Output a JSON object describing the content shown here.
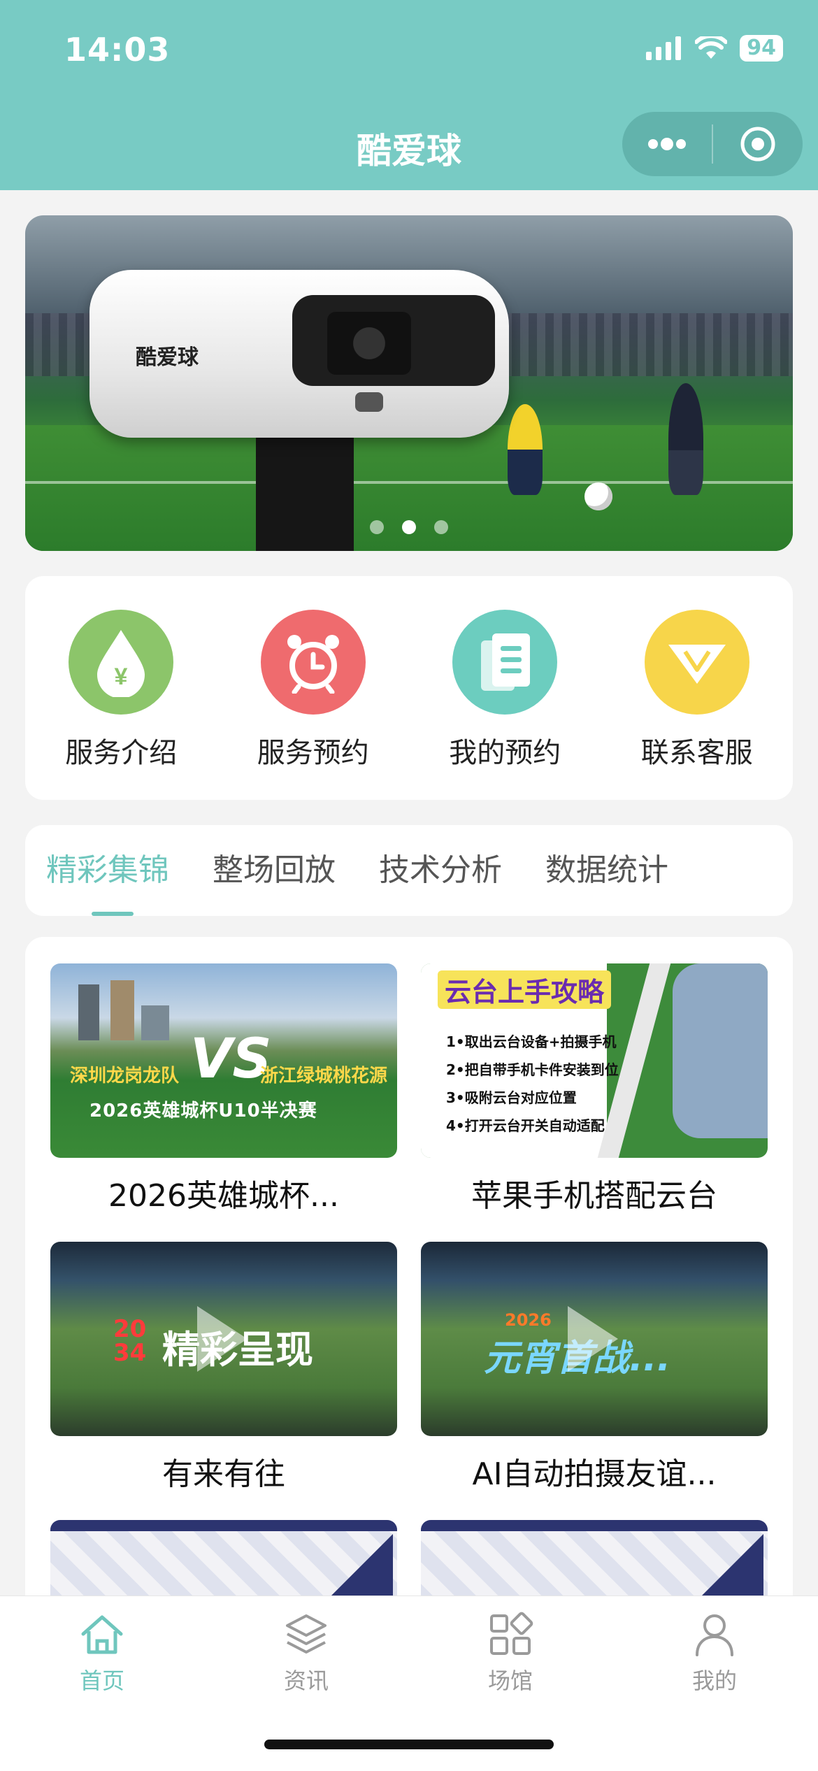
{
  "status_bar": {
    "time": "14:03",
    "battery": "94"
  },
  "app": {
    "title": "酷爱球"
  },
  "banner": {
    "camera_logo": "酷爱球",
    "dot_count": 3,
    "active_dot": 2
  },
  "services": [
    {
      "label": "服务介绍",
      "icon": "money-drop-icon",
      "color": "#8cc56a"
    },
    {
      "label": "服务预约",
      "icon": "alarm-clock-icon",
      "color": "#ef6b6e"
    },
    {
      "label": "我的预约",
      "icon": "document-icon",
      "color": "#6ccdbf"
    },
    {
      "label": "联系客服",
      "icon": "diamond-icon",
      "color": "#f7d54a"
    }
  ],
  "tabs": [
    {
      "label": "精彩集锦",
      "active": true
    },
    {
      "label": "整场回放",
      "active": false
    },
    {
      "label": "技术分析",
      "active": false
    },
    {
      "label": "数据统计",
      "active": false
    }
  ],
  "videos": [
    {
      "caption": "2026英雄城杯...",
      "overlay_left": "深圳龙岗龙队",
      "overlay_vs": "VS",
      "overlay_right": "浙江绿城桃花源",
      "overlay_bottom": "2026英雄城杯U10半决赛"
    },
    {
      "caption": "苹果手机搭配云台",
      "overlay_title": "云台上手攻略",
      "steps": [
        "1•取出云台设备+拍摄手机",
        "2•把自带手机卡件安装到位",
        "3•吸附云台对应位置",
        "4•打开云台开关自动适配"
      ]
    },
    {
      "caption": "有来有往",
      "overlay_num": "20 34",
      "overlay_title": "精彩呈现"
    },
    {
      "caption": "AI自动拍摄友谊...",
      "overlay_year": "2026",
      "overlay_title": "元宵首战..."
    }
  ],
  "tabbar": [
    {
      "label": "首页",
      "icon": "home-icon",
      "active": true
    },
    {
      "label": "资讯",
      "icon": "layers-icon",
      "active": false
    },
    {
      "label": "场馆",
      "icon": "grid-icon",
      "active": false
    },
    {
      "label": "我的",
      "icon": "user-icon",
      "active": false
    }
  ],
  "colors": {
    "brand": "#78cbc4",
    "accent": "#6fc6bd"
  }
}
